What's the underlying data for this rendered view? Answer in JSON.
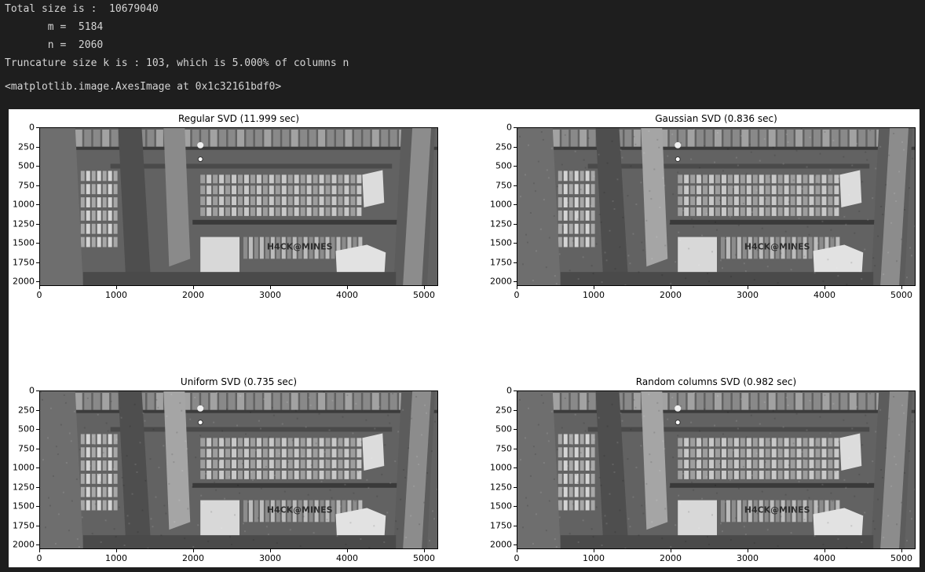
{
  "output_lines": {
    "total_size": "Total size is :  10679040",
    "m": "       m =  5184",
    "n": "       n =  2060",
    "truncature": "Truncature size k is : 103, which is 5.000% of columns n",
    "axes_repr": "<matplotlib.image.AxesImage at 0x1c32161bdf0>"
  },
  "chart_data": [
    {
      "type": "image",
      "title": "Regular SVD (11.999 sec)",
      "xticks": [
        "0",
        "1000",
        "2000",
        "3000",
        "4000",
        "5000"
      ],
      "yticks": [
        "0",
        "250",
        "500",
        "750",
        "1000",
        "1250",
        "1500",
        "1750",
        "2000"
      ],
      "xlim": [
        0,
        5184
      ],
      "ylim": [
        2060,
        0
      ],
      "image_text": "H4CK@MINES",
      "colormap": "gray"
    },
    {
      "type": "image",
      "title": "Gaussian SVD (0.836 sec)",
      "xticks": [
        "0",
        "1000",
        "2000",
        "3000",
        "4000",
        "5000"
      ],
      "yticks": [
        "0",
        "250",
        "500",
        "750",
        "1000",
        "1250",
        "1500",
        "1750",
        "2000"
      ],
      "xlim": [
        0,
        5184
      ],
      "ylim": [
        2060,
        0
      ],
      "image_text": "H4CK@MINES",
      "colormap": "gray"
    },
    {
      "type": "image",
      "title": "Uniform SVD (0.735 sec)",
      "xticks": [
        "0",
        "1000",
        "2000",
        "3000",
        "4000",
        "5000"
      ],
      "yticks": [
        "0",
        "250",
        "500",
        "750",
        "1000",
        "1250",
        "1500",
        "1750",
        "2000"
      ],
      "xlim": [
        0,
        5184
      ],
      "ylim": [
        2060,
        0
      ],
      "image_text": "H4CK@MINES",
      "colormap": "gray"
    },
    {
      "type": "image",
      "title": "Random columns SVD (0.982 sec)",
      "xticks": [
        "0",
        "1000",
        "2000",
        "3000",
        "4000",
        "5000"
      ],
      "yticks": [
        "0",
        "250",
        "500",
        "750",
        "1000",
        "1250",
        "1500",
        "1750",
        "2000"
      ],
      "xlim": [
        0,
        5184
      ],
      "ylim": [
        2060,
        0
      ],
      "image_text": "H4CK@MINES",
      "colormap": "gray"
    }
  ]
}
